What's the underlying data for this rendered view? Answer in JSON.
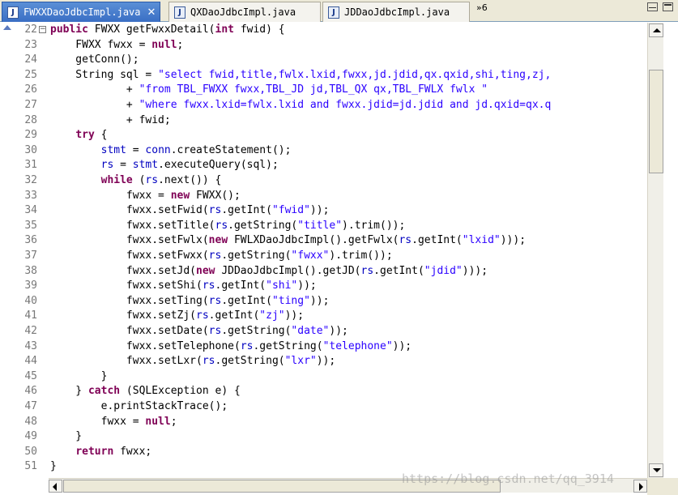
{
  "tabs": [
    {
      "label": "FWXXDaoJdbcImpl.java",
      "active": true,
      "icon": "java-file-icon"
    },
    {
      "label": "QXDaoJdbcImpl.java",
      "active": false,
      "icon": "java-file-icon"
    },
    {
      "label": "JDDaoJdbcImpl.java",
      "active": false,
      "icon": "java-file-icon"
    }
  ],
  "overflow_label": "»6",
  "code_lines": [
    {
      "n": "22",
      "html": "<span class='kw'>public</span> FWXX getFwxxDetail(<span class='kw'>int</span> fwid) {"
    },
    {
      "n": "23",
      "html": "    FWXX fwxx = <span class='kw'>null</span>;"
    },
    {
      "n": "24",
      "html": "    getConn();"
    },
    {
      "n": "25",
      "html": "    String sql = <span class='str'>\"select fwid,title,fwlx.lxid,fwxx,jd.jdid,qx.qxid,shi,ting,zj,</span>"
    },
    {
      "n": "26",
      "html": "            + <span class='str'>\"from TBL_FWXX fwxx,TBL_JD jd,TBL_QX qx,TBL_FWLX fwlx \"</span>"
    },
    {
      "n": "27",
      "html": "            + <span class='str'>\"where fwxx.lxid=fwlx.lxid and fwxx.jdid=jd.jdid and jd.qxid=qx.q</span>"
    },
    {
      "n": "28",
      "html": "            + fwid;"
    },
    {
      "n": "29",
      "html": "    <span class='kw'>try</span> {"
    },
    {
      "n": "30",
      "html": "        <span class='fld'>stmt</span> = <span class='fld'>conn</span>.createStatement();"
    },
    {
      "n": "31",
      "html": "        <span class='fld'>rs</span> = <span class='fld'>stmt</span>.executeQuery(sql);"
    },
    {
      "n": "32",
      "html": "        <span class='kw'>while</span> (<span class='fld'>rs</span>.next()) {"
    },
    {
      "n": "33",
      "html": "            fwxx = <span class='kw'>new</span> FWXX();"
    },
    {
      "n": "34",
      "html": "            fwxx.setFwid(<span class='fld'>rs</span>.getInt(<span class='str'>\"fwid\"</span>));"
    },
    {
      "n": "35",
      "html": "            fwxx.setTitle(<span class='fld'>rs</span>.getString(<span class='str'>\"title\"</span>).trim());"
    },
    {
      "n": "36",
      "html": "            fwxx.setFwlx(<span class='kw'>new</span> FWLXDaoJdbcImpl().getFwlx(<span class='fld'>rs</span>.getInt(<span class='str'>\"lxid\"</span>)));"
    },
    {
      "n": "37",
      "html": "            fwxx.setFwxx(<span class='fld'>rs</span>.getString(<span class='str'>\"fwxx\"</span>).trim());"
    },
    {
      "n": "38",
      "html": "            fwxx.setJd(<span class='kw'>new</span> JDDaoJdbcImpl().getJD(<span class='fld'>rs</span>.getInt(<span class='str'>\"jdid\"</span>)));"
    },
    {
      "n": "39",
      "html": "            fwxx.setShi(<span class='fld'>rs</span>.getInt(<span class='str'>\"shi\"</span>));"
    },
    {
      "n": "40",
      "html": "            fwxx.setTing(<span class='fld'>rs</span>.getInt(<span class='str'>\"ting\"</span>));"
    },
    {
      "n": "41",
      "html": "            fwxx.setZj(<span class='fld'>rs</span>.getInt(<span class='str'>\"zj\"</span>));"
    },
    {
      "n": "42",
      "html": "            fwxx.setDate(<span class='fld'>rs</span>.getString(<span class='str'>\"date\"</span>));"
    },
    {
      "n": "43",
      "html": "            fwxx.setTelephone(<span class='fld'>rs</span>.getString(<span class='str'>\"telephone\"</span>));"
    },
    {
      "n": "44",
      "html": "            fwxx.setLxr(<span class='fld'>rs</span>.getString(<span class='str'>\"lxr\"</span>));"
    },
    {
      "n": "45",
      "html": "        }"
    },
    {
      "n": "46",
      "html": "    } <span class='kw'>catch</span> (SQLException e) {"
    },
    {
      "n": "47",
      "html": "        e.printStackTrace();"
    },
    {
      "n": "48",
      "html": "        fwxx = <span class='kw'>null</span>;"
    },
    {
      "n": "49",
      "html": "    }"
    },
    {
      "n": "50",
      "html": "    <span class='kw'>return</span> fwxx;"
    },
    {
      "n": "51",
      "html": "}"
    }
  ],
  "watermark": "https://blog.csdn.net/qq_3914",
  "colors": {
    "keyword": "#7f0055",
    "string": "#2a00ff",
    "field": "#0000c0",
    "line_number": "#787878"
  }
}
